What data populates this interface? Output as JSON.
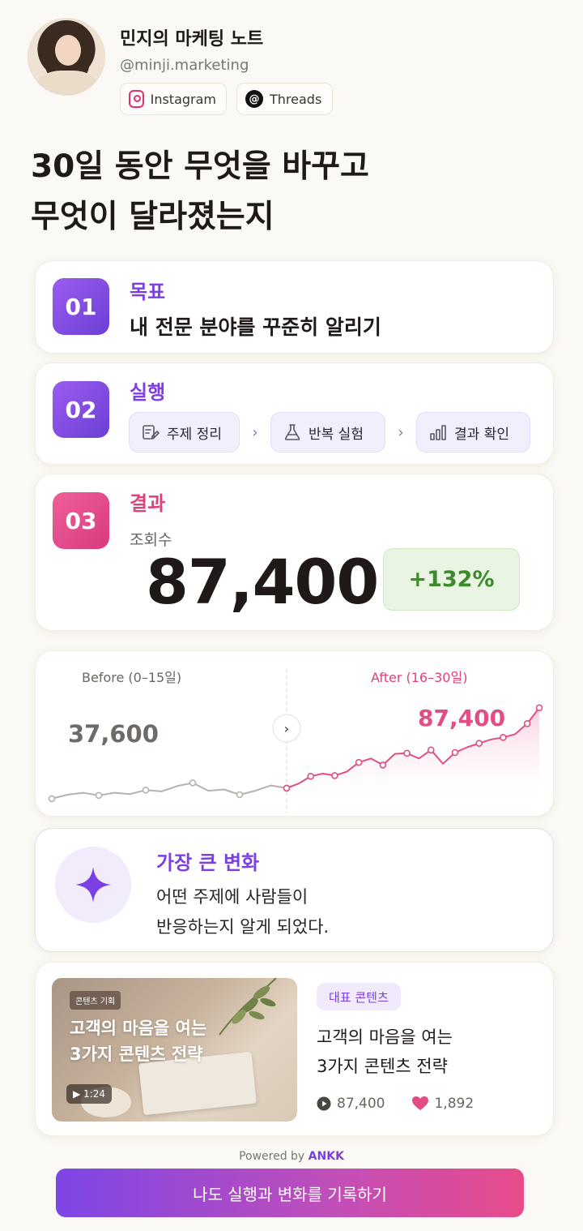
{
  "profile": {
    "name": "민지의 마케팅 노트",
    "handle": "@minji.marketing",
    "links": [
      {
        "label": "Instagram",
        "icon": "instagram-icon"
      },
      {
        "label": "Threads",
        "icon": "threads-icon"
      }
    ]
  },
  "headline": {
    "line1": "30일 동안 무엇을 바꾸고",
    "line2": "무엇이 달라졌는지"
  },
  "goal": {
    "number": "01",
    "label": "목표",
    "text": "내 전문 분야를 꾸준히 알리기"
  },
  "action": {
    "number": "02",
    "label": "실행",
    "steps": [
      {
        "label": "주제 정리",
        "icon": "edit-note-icon"
      },
      {
        "label": "반복 실험",
        "icon": "flask-icon"
      },
      {
        "label": "결과 확인",
        "icon": "bar-chart-icon"
      }
    ],
    "arrow": "›"
  },
  "result": {
    "number": "03",
    "label": "결과",
    "metric_label": "조회수",
    "metric_value": "87,400",
    "growth": "+132%"
  },
  "comparison": {
    "before_label": "Before (0–15일)",
    "before_value": "37,600",
    "after_label": "After (16–30일)",
    "after_value": "87,400",
    "toggle": "›"
  },
  "chart_data": {
    "type": "line",
    "series": [
      {
        "values": [
          1.0,
          1.6,
          1.9,
          1.5,
          1.9,
          1.7,
          2.3,
          2.1,
          2.9,
          3.4,
          2.2,
          2.4,
          1.6,
          2.2,
          3.0,
          2.6
        ]
      },
      {
        "values": [
          2.6,
          3.3,
          4.4,
          4.8,
          4.5,
          5.1,
          6.5,
          7.1,
          6.1,
          7.8,
          7.9,
          7.1,
          8.4,
          6.3,
          8.0,
          8.8,
          9.4,
          10.0,
          10.3,
          10.8,
          12.4,
          14.8
        ]
      }
    ],
    "colors": {
      "before": "#b6b2ad",
      "after": "#e24d86"
    }
  },
  "insight": {
    "label": "가장 큰 변화",
    "line1": "어떤 주제에 사람들이",
    "line2": "반응하는지 알게 되었다."
  },
  "featured": {
    "tag": "대표 콘텐츠",
    "title_line1": "고객의 마음을 여는",
    "title_line2": "3가지 콘텐츠 전략",
    "thumb_tag": "콘텐츠 기획",
    "thumb_title_line1": "고객의 마음을 여는",
    "thumb_title_line2": "3가지 콘텐츠 전략",
    "duration": "▶ 1:24",
    "views": "87,400",
    "likes": "1,892"
  },
  "footer": {
    "powered_prefix": "Powered by ",
    "powered_brand": "ANKK",
    "cta": "나도 실행과 변화를 기록하기"
  },
  "colors": {
    "accent_purple": "#7b3fe4",
    "accent_pink": "#e0407c",
    "growth_green": "#3d8a2a"
  }
}
